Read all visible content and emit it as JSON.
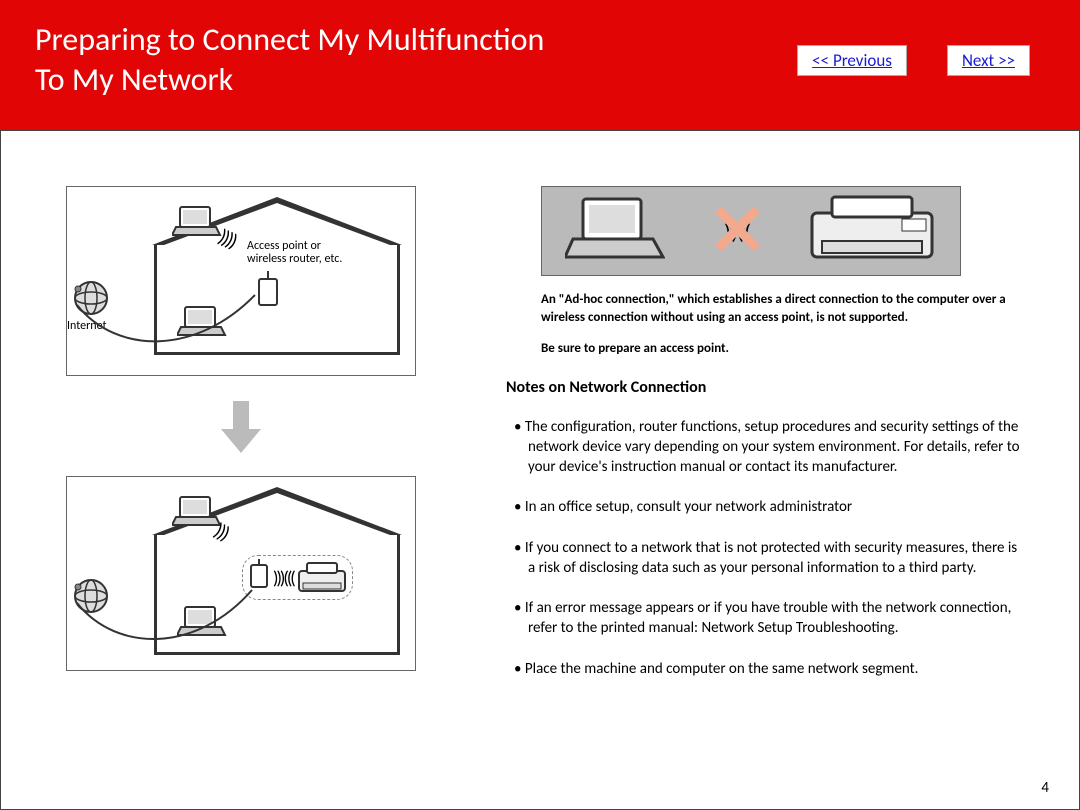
{
  "header": {
    "title_line1": "Preparing to Connect My Multifunction",
    "title_line2": "To My Network",
    "prev_label": "<< Previous",
    "next_label": "Next >>"
  },
  "diagram": {
    "internet_label": "Internet",
    "ap_label": "Access point or\nwireless router, etc."
  },
  "adhoc": {
    "para1": "An \"Ad-hoc connection,\" which establishes a direct connection to the computer over a wireless connection without using an access point, is not supported.",
    "para2": "Be sure to prepare an access point."
  },
  "notes": {
    "heading": "Notes on Network Connection",
    "items": [
      "The configuration, router functions, setup procedures and security settings of the network device vary depending on your system environment. For details, refer to your device's instruction manual or contact its manufacturer.",
      "In an office setup, consult your network administrator",
      "If you connect to a network that is not protected with security measures, there is a risk of disclosing data such as your personal information to a third party.",
      "If an error message appears or if you have trouble with the network connection, refer to the printed manual: Network Setup Troubleshooting.",
      "Place the machine and computer on the same network segment."
    ]
  },
  "page_number": "4"
}
